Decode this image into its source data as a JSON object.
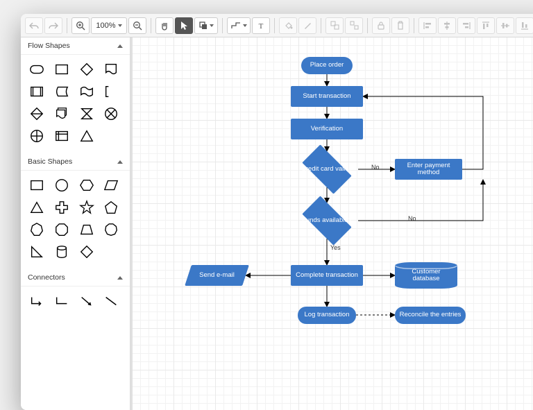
{
  "toolbar": {
    "zoom": "100%"
  },
  "sidebar": {
    "sections": {
      "flow": "Flow Shapes",
      "basic": "Basic Shapes",
      "connectors": "Connectors"
    }
  },
  "flow": {
    "nodes": {
      "place_order": "Place order",
      "start_transaction": "Start transaction",
      "verification": "Verification",
      "credit_valid": "Credit card valid?",
      "enter_payment": "Enter payment method",
      "funds_available": "Funds available?",
      "send_email": "Send e-mail",
      "complete_transaction": "Complete transaction",
      "customer_database": "Customer database",
      "log_transaction": "Log transaction",
      "reconcile": "Reconcile the entries"
    },
    "labels": {
      "no1": "No",
      "no2": "No",
      "yes": "Yes"
    }
  },
  "chart_data": {
    "type": "flowchart",
    "nodes": [
      {
        "id": "place_order",
        "shape": "terminator",
        "text": "Place order"
      },
      {
        "id": "start_transaction",
        "shape": "process",
        "text": "Start transaction"
      },
      {
        "id": "verification",
        "shape": "process",
        "text": "Verification"
      },
      {
        "id": "credit_valid",
        "shape": "decision",
        "text": "Credit card valid?"
      },
      {
        "id": "enter_payment",
        "shape": "process",
        "text": "Enter payment method"
      },
      {
        "id": "funds_available",
        "shape": "decision",
        "text": "Funds available?"
      },
      {
        "id": "send_email",
        "shape": "data",
        "text": "Send e-mail"
      },
      {
        "id": "complete_transaction",
        "shape": "process",
        "text": "Complete transaction"
      },
      {
        "id": "customer_database",
        "shape": "database",
        "text": "Customer database"
      },
      {
        "id": "log_transaction",
        "shape": "terminator",
        "text": "Log transaction"
      },
      {
        "id": "reconcile",
        "shape": "terminator",
        "text": "Reconcile the entries"
      }
    ],
    "edges": [
      {
        "from": "place_order",
        "to": "start_transaction"
      },
      {
        "from": "start_transaction",
        "to": "verification"
      },
      {
        "from": "verification",
        "to": "credit_valid"
      },
      {
        "from": "credit_valid",
        "to": "enter_payment",
        "label": "No"
      },
      {
        "from": "enter_payment",
        "to": "start_transaction"
      },
      {
        "from": "credit_valid",
        "to": "funds_available"
      },
      {
        "from": "funds_available",
        "to": "enter_payment",
        "label": "No"
      },
      {
        "from": "funds_available",
        "to": "complete_transaction",
        "label": "Yes"
      },
      {
        "from": "complete_transaction",
        "to": "send_email"
      },
      {
        "from": "complete_transaction",
        "to": "customer_database"
      },
      {
        "from": "complete_transaction",
        "to": "log_transaction"
      },
      {
        "from": "log_transaction",
        "to": "reconcile",
        "style": "dashed"
      }
    ]
  }
}
